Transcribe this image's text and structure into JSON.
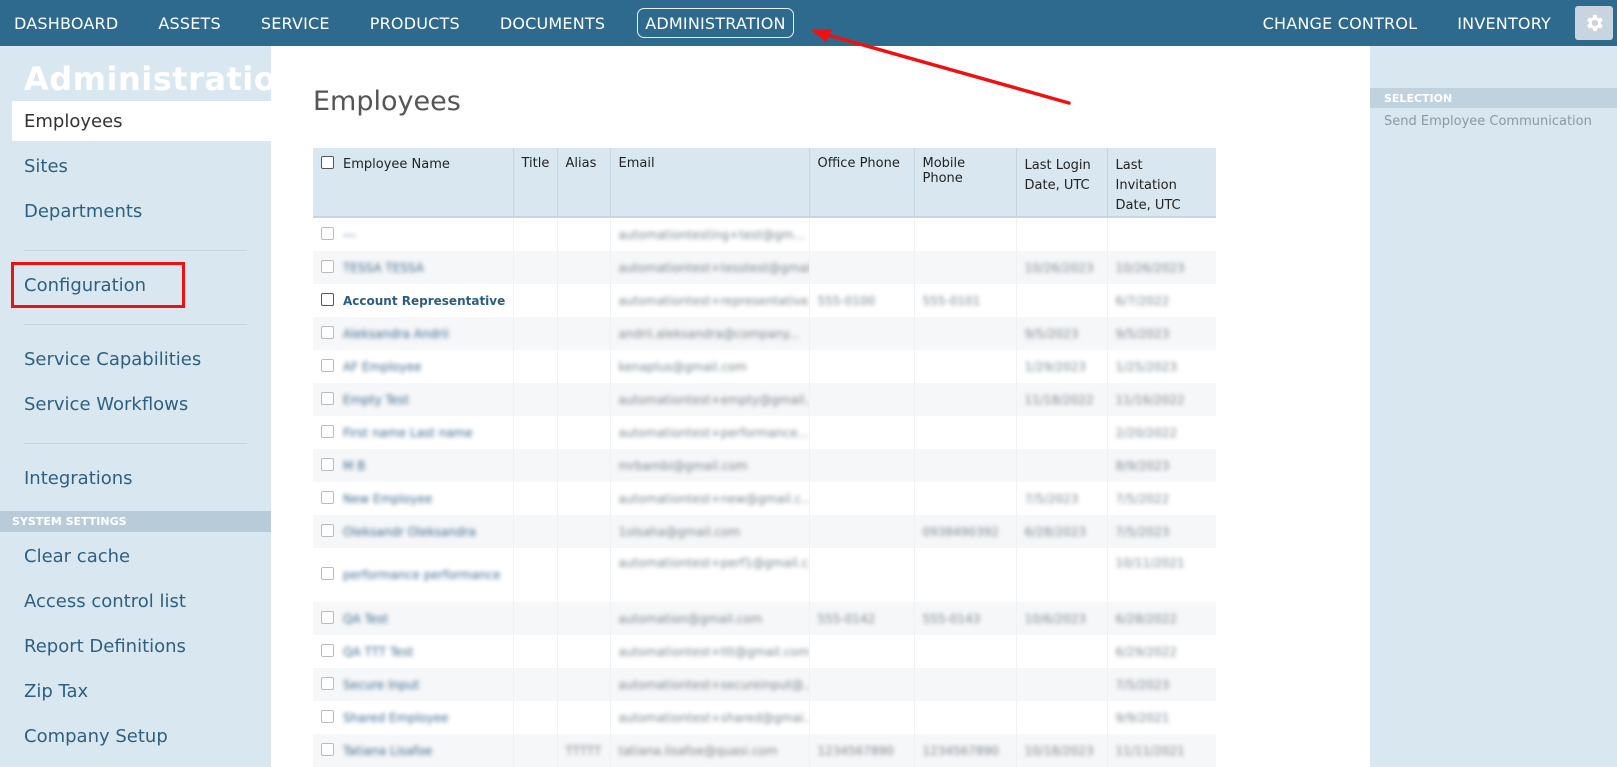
{
  "topnav": {
    "items": [
      "DASHBOARD",
      "ASSETS",
      "SERVICE",
      "PRODUCTS",
      "DOCUMENTS",
      "ADMINISTRATION"
    ],
    "right_items": [
      "CHANGE CONTROL",
      "INVENTORY"
    ],
    "active": "ADMINISTRATION",
    "gear_icon": "gear-icon"
  },
  "sidebar": {
    "heading": "Administration",
    "items": [
      "Employees",
      "Sites",
      "Departments",
      "Configuration",
      "Service Capabilities",
      "Service Workflows",
      "Integrations"
    ],
    "system_header": "SYSTEM SETTINGS",
    "system_items": [
      "Clear cache",
      "Access control list",
      "Report Definitions",
      "Zip Tax",
      "Company Setup"
    ]
  },
  "main": {
    "title": "Employees",
    "columns": [
      "Employee Name",
      "Title",
      "Alias",
      "Email",
      "Office Phone",
      "Mobile Phone",
      "Last Login Date, UTC",
      "Last Invitation Date, UTC"
    ],
    "rows": [
      {
        "name": "---",
        "email": "automationtesting+test@gm..."
      },
      {
        "name": "Account Representative",
        "email": "automationtest+representative...",
        "office": "555-0100",
        "mobile": "555-0101",
        "invite": "6/7/2022"
      }
    ]
  },
  "right_panel": {
    "header": "SELECTION",
    "action": "Send Employee Communication"
  },
  "colors": {
    "nav_bg": "#2e6a8e",
    "sidebar_bg": "#d9e8f0",
    "annotation_red": "#ee1111"
  }
}
